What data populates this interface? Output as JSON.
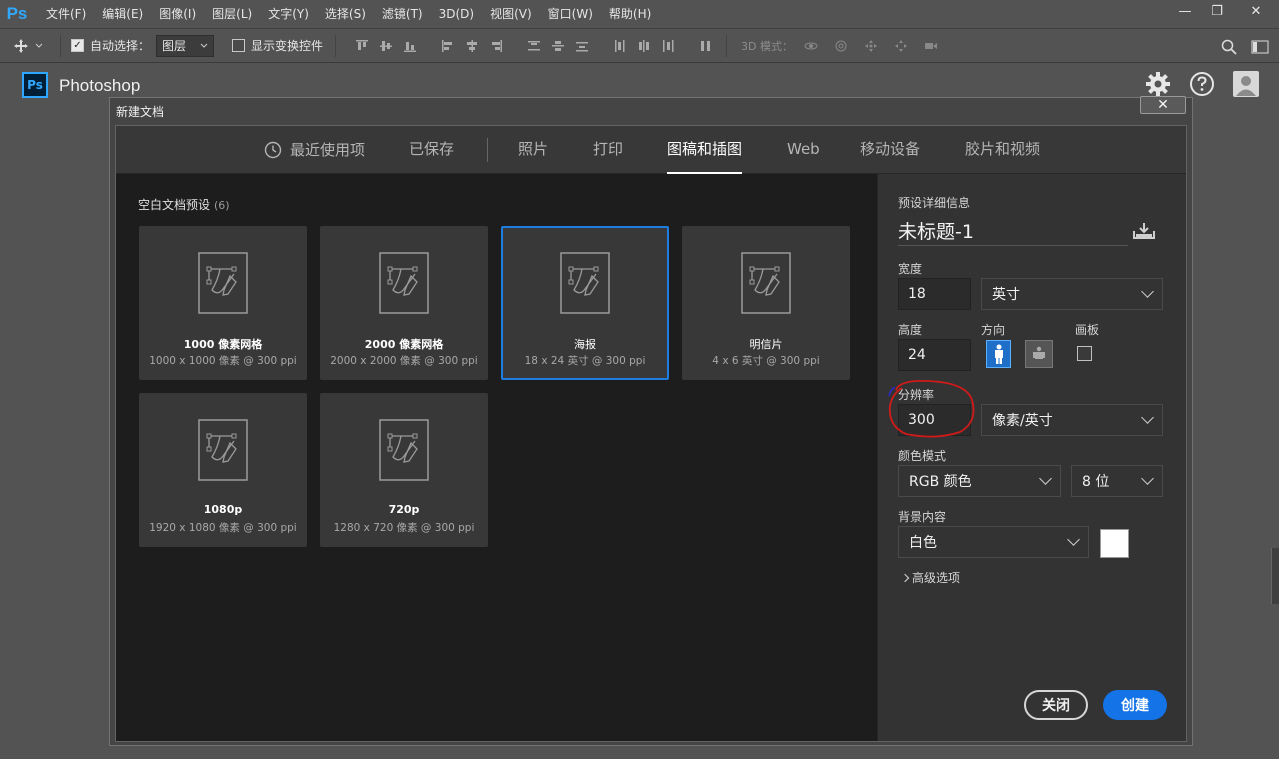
{
  "app": {
    "logo": "Ps",
    "menus": [
      "文件(F)",
      "编辑(E)",
      "图像(I)",
      "图层(L)",
      "文字(Y)",
      "选择(S)",
      "滤镜(T)",
      "3D(D)",
      "视图(V)",
      "窗口(W)",
      "帮助(H)"
    ],
    "window_controls": {
      "minimize": "—",
      "restore": "❐",
      "close": "✕"
    }
  },
  "options_bar": {
    "auto_select_label": "自动选择：",
    "auto_select_checked": true,
    "layer_select": "图层",
    "show_transform_label": "显示变换控件",
    "mode_3d_label": "3D 模式："
  },
  "home": {
    "logo": "Ps",
    "title": "Photoshop"
  },
  "dialog": {
    "title": "新建文档",
    "close_glyph": "✕",
    "tabs": [
      "最近使用项",
      "已保存",
      "照片",
      "打印",
      "图稿和插图",
      "Web",
      "移动设备",
      "胶片和视频"
    ],
    "active_tab": "图稿和插图",
    "presets_title": "空白文档预设",
    "presets_count": "(6)",
    "presets": [
      {
        "name": "1000 像素网格",
        "desc": "1000 x 1000 像素 @ 300 ppi"
      },
      {
        "name": "2000 像素网格",
        "desc": "2000 x 2000 像素 @ 300 ppi"
      },
      {
        "name": "海报",
        "desc": "18 x 24 英寸 @ 300 ppi"
      },
      {
        "name": "明信片",
        "desc": "4 x 6 英寸 @ 300 ppi"
      },
      {
        "name": "1080p",
        "desc": "1920 x 1080 像素 @ 300 ppi"
      },
      {
        "name": "720p",
        "desc": "1280 x 720 像素 @ 300 ppi"
      }
    ],
    "selected_preset": "海报",
    "details": {
      "header": "预设详细信息",
      "doc_name": "未标题-1",
      "width_label": "宽度",
      "width_value": "18",
      "width_unit": "英寸",
      "height_label": "高度",
      "height_value": "24",
      "orientation_label": "方向",
      "artboard_label": "画板",
      "resolution_label": "分辨率",
      "resolution_value": "300",
      "resolution_unit": "像素/英寸",
      "color_mode_label": "颜色模式",
      "color_mode": "RGB 颜色",
      "bit_depth": "8 位",
      "background_label": "背景内容",
      "background": "白色",
      "background_color": "#ffffff",
      "advanced_label": "高级选项",
      "close_button": "关闭",
      "create_button": "创建"
    }
  },
  "colors": {
    "accent": "#1473e6",
    "ps_blue": "#31a8ff",
    "annotation_red": "#d11a1a"
  }
}
